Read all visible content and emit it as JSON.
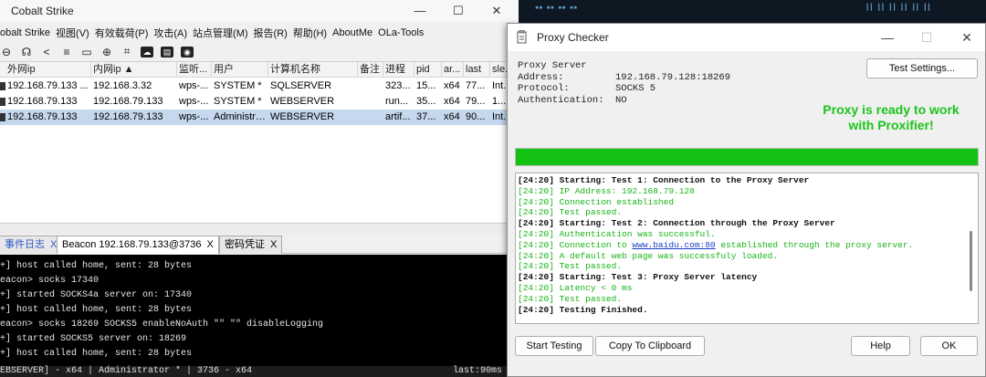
{
  "cobalt_strike": {
    "title": "Cobalt Strike",
    "menu": [
      "obalt Strike",
      "视图(V)",
      "有效载荷(P)",
      "攻击(A)",
      "站点管理(M)",
      "报告(R)",
      "帮助(H)",
      "AboutMe",
      "OLa-Tools"
    ],
    "toolbar_icons": [
      "minus-circle-icon",
      "headphones-icon",
      "share-icon",
      "list-icon",
      "screen-icon",
      "globe-icon",
      "keys-icon",
      "cloud-icon",
      "card-icon",
      "camera-icon"
    ],
    "columns": [
      "外网ip",
      "内网ip ▲",
      "监听...",
      "用户",
      "计算机名称",
      "备注",
      "进程",
      "pid",
      "ar...",
      "last",
      "sle..."
    ],
    "rows": [
      [
        "192.168.79.133 ...",
        "192.168.3.32",
        "wps-...",
        "SYSTEM *",
        "SQLSERVER",
        "",
        "323...",
        "15...",
        "x64",
        "77...",
        "Int..."
      ],
      [
        "192.168.79.133",
        "192.168.79.133",
        "wps-...",
        "SYSTEM *",
        "WEBSERVER",
        "",
        "run...",
        "35...",
        "x64",
        "79...",
        "1..."
      ],
      [
        "192.168.79.133",
        "192.168.79.133",
        "wps-...",
        "Administra...",
        "WEBSERVER",
        "",
        "artif...",
        "37...",
        "x64",
        "90...",
        "Int..."
      ]
    ],
    "tabs": [
      {
        "label": "事件日志",
        "close": "X"
      },
      {
        "label": "Beacon 192.168.79.133@3736",
        "close": "X"
      },
      {
        "label": "密码凭证",
        "close": "X"
      }
    ],
    "console": [
      "+] host called home, sent: 28 bytes",
      "eacon> socks 17340",
      "+] started SOCKS4a server on: 17340",
      "+] host called home, sent: 28 bytes",
      "eacon> socks 18269 SOCKS5 enableNoAuth \"\" \"\" disableLogging",
      "+] started SOCKS5 server on: 18269",
      "+] host called home, sent: 28 bytes"
    ],
    "status_left": "EBSERVER] - x64 | Administrator * | 3736 - x64",
    "status_right": "last:90ms"
  },
  "proxy_checker": {
    "title": "Proxy Checker",
    "info": [
      {
        "label": "Proxy Server",
        "value": ""
      },
      {
        "label": "Address:",
        "value": "192.168.79.128:18269"
      },
      {
        "label": "Protocol:",
        "value": "SOCKS 5"
      },
      {
        "label": "Authentication:",
        "value": "NO"
      }
    ],
    "test_settings_label": "Test Settings...",
    "ready_line1": "Proxy is ready to work",
    "ready_line2": "with Proxifier!",
    "progress": 1.0,
    "colors": {
      "ok_green": "#17b317",
      "progress_green": "#13c213",
      "ready_green": "#1bc41b"
    },
    "log": [
      {
        "kind": "dk",
        "text": "[24:20] Starting: Test 1: Connection to the Proxy Server"
      },
      {
        "kind": "ok",
        "text": "[24:20] IP Address: 192.168.79.128"
      },
      {
        "kind": "ok",
        "text": "[24:20] Connection established"
      },
      {
        "kind": "ok",
        "text": "[24:20] Test passed."
      },
      {
        "kind": "dk",
        "text": "[24:20] Starting: Test 2: Connection through the Proxy Server"
      },
      {
        "kind": "ok",
        "text": "[24:20] Authentication was successful."
      },
      {
        "kind": "ok",
        "pre": "[24:20] Connection to ",
        "link": "www.baidu.com:80",
        "post": " established through the proxy server."
      },
      {
        "kind": "ok",
        "text": "[24:20] A default web page was successfuly loaded."
      },
      {
        "kind": "ok",
        "text": "[24:20] Test passed."
      },
      {
        "kind": "dk",
        "text": "[24:20] Starting: Test 3: Proxy Server latency"
      },
      {
        "kind": "ok",
        "text": "[24:20] Latency < 0 ms"
      },
      {
        "kind": "ok",
        "text": "[24:20] Test passed."
      },
      {
        "kind": "dk",
        "text": "[24:20] Testing Finished."
      }
    ],
    "buttons": {
      "start": "Start Testing",
      "copy": "Copy To Clipboard",
      "help": "Help",
      "ok": "OK"
    }
  }
}
